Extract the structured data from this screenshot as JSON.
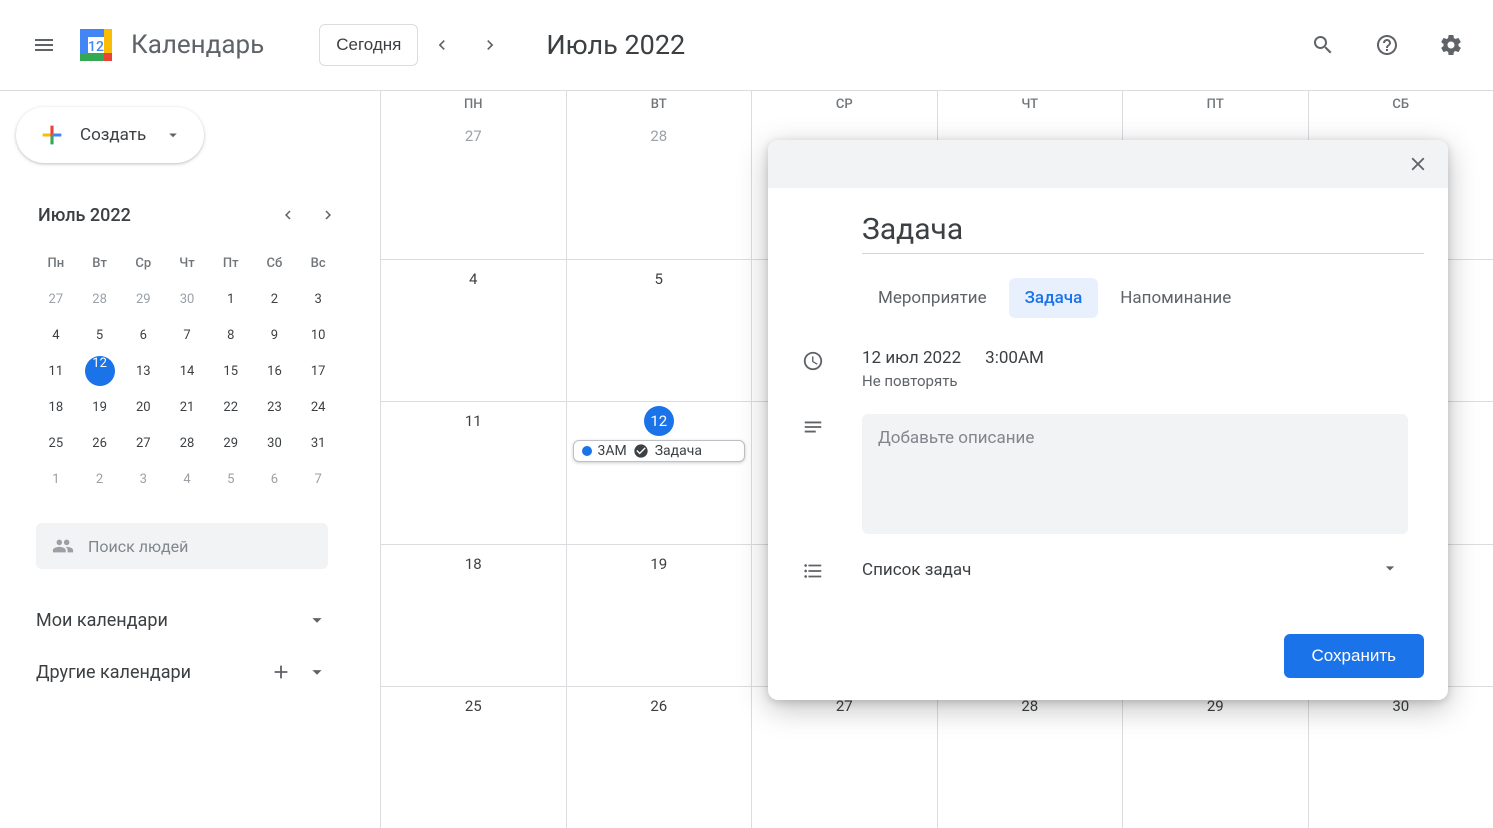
{
  "header": {
    "app_name": "Календарь",
    "today_label": "Сегодня",
    "month_title": "Июль 2022"
  },
  "sidebar": {
    "create_label": "Создать",
    "mini_title": "Июль 2022",
    "dow": [
      "Пн",
      "Вт",
      "Ср",
      "Чт",
      "Пт",
      "Сб",
      "Вс"
    ],
    "weeks": [
      [
        {
          "n": "27",
          "dim": true
        },
        {
          "n": "28",
          "dim": true
        },
        {
          "n": "29",
          "dim": true
        },
        {
          "n": "30",
          "dim": true
        },
        {
          "n": "1"
        },
        {
          "n": "2"
        },
        {
          "n": "3"
        }
      ],
      [
        {
          "n": "4"
        },
        {
          "n": "5"
        },
        {
          "n": "6"
        },
        {
          "n": "7"
        },
        {
          "n": "8"
        },
        {
          "n": "9"
        },
        {
          "n": "10"
        }
      ],
      [
        {
          "n": "11"
        },
        {
          "n": "12",
          "today": true
        },
        {
          "n": "13"
        },
        {
          "n": "14"
        },
        {
          "n": "15"
        },
        {
          "n": "16"
        },
        {
          "n": "17"
        }
      ],
      [
        {
          "n": "18"
        },
        {
          "n": "19"
        },
        {
          "n": "20"
        },
        {
          "n": "21"
        },
        {
          "n": "22"
        },
        {
          "n": "23"
        },
        {
          "n": "24"
        }
      ],
      [
        {
          "n": "25"
        },
        {
          "n": "26"
        },
        {
          "n": "27"
        },
        {
          "n": "28"
        },
        {
          "n": "29"
        },
        {
          "n": "30"
        },
        {
          "n": "31"
        }
      ],
      [
        {
          "n": "1",
          "dim": true
        },
        {
          "n": "2",
          "dim": true
        },
        {
          "n": "3",
          "dim": true
        },
        {
          "n": "4",
          "dim": true
        },
        {
          "n": "5",
          "dim": true
        },
        {
          "n": "6",
          "dim": true
        },
        {
          "n": "7",
          "dim": true
        }
      ]
    ],
    "search_people": "Поиск людей",
    "my_calendars": "Мои календари",
    "other_calendars": "Другие календари"
  },
  "grid": {
    "dow": [
      "ПН",
      "ВТ",
      "СР",
      "ЧТ",
      "ПТ",
      "СБ"
    ],
    "weeks": [
      [
        {
          "n": "27",
          "dim": true
        },
        {
          "n": "28",
          "dim": true
        },
        {
          "n": ""
        },
        {
          "n": ""
        },
        {
          "n": ""
        },
        {
          "n": ""
        }
      ],
      [
        {
          "n": "4"
        },
        {
          "n": "5"
        },
        {
          "n": ""
        },
        {
          "n": ""
        },
        {
          "n": ""
        },
        {
          "n": ""
        }
      ],
      [
        {
          "n": "11"
        },
        {
          "n": "12",
          "today": true,
          "event": true
        },
        {
          "n": ""
        },
        {
          "n": ""
        },
        {
          "n": ""
        },
        {
          "n": ""
        }
      ],
      [
        {
          "n": "18"
        },
        {
          "n": "19"
        },
        {
          "n": ""
        },
        {
          "n": ""
        },
        {
          "n": ""
        },
        {
          "n": ""
        }
      ],
      [
        {
          "n": "25"
        },
        {
          "n": "26"
        },
        {
          "n": "27"
        },
        {
          "n": "28"
        },
        {
          "n": "29"
        },
        {
          "n": "30"
        }
      ]
    ],
    "event": {
      "time": "3AM",
      "title": "Задача"
    }
  },
  "dialog": {
    "title": "Задача",
    "tabs": {
      "event": "Мероприятие",
      "task": "Задача",
      "reminder": "Напоминание"
    },
    "date": "12 июл 2022",
    "time": "3:00AM",
    "repeat": "Не повторять",
    "desc_placeholder": "Добавьте описание",
    "list_label": "Список задач",
    "save": "Сохранить"
  }
}
